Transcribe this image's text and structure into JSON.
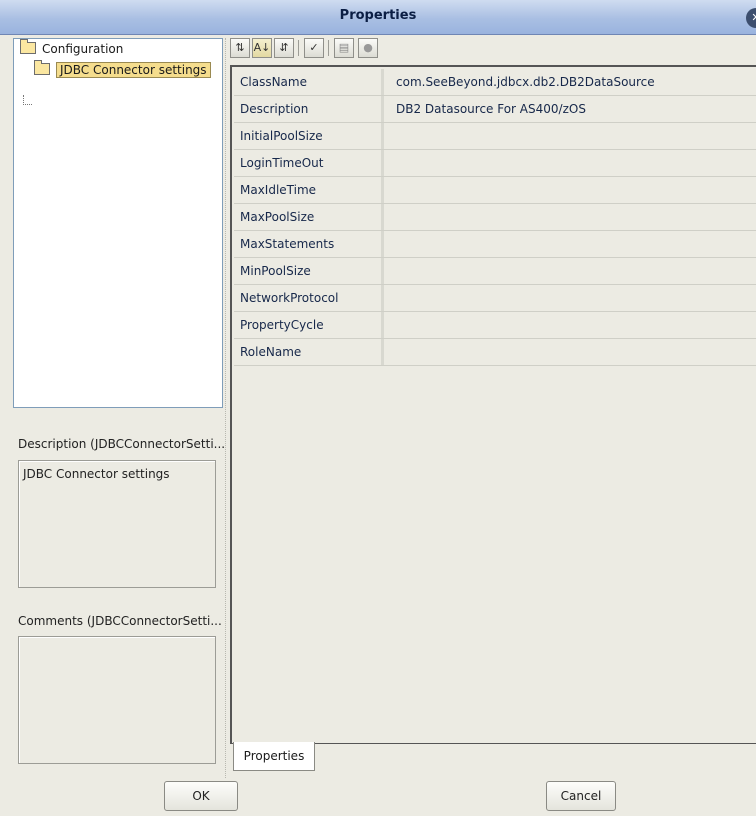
{
  "window": {
    "title": "Properties"
  },
  "tree": {
    "items": [
      {
        "label": "Configuration"
      },
      {
        "label": "JDBC Connector settings"
      }
    ]
  },
  "description": {
    "label": "Description (JDBCConnectorSetti...",
    "text": "JDBC Connector settings"
  },
  "comments": {
    "label": "Comments (JDBCConnectorSetti...",
    "text": ""
  },
  "toolbar": {
    "icons": [
      "collapse-icon",
      "sort-alpha-icon",
      "sort-category-icon",
      "checklist-icon",
      "list-view-icon",
      "help-icon"
    ]
  },
  "properties": [
    {
      "name": "ClassName",
      "value": "com.SeeBeyond.jdbcx.db2.DB2DataSource"
    },
    {
      "name": "Description",
      "value": "DB2 Datasource For AS400/zOS"
    },
    {
      "name": "InitialPoolSize",
      "value": ""
    },
    {
      "name": "LoginTimeOut",
      "value": ""
    },
    {
      "name": "MaxIdleTime",
      "value": ""
    },
    {
      "name": "MaxPoolSize",
      "value": ""
    },
    {
      "name": "MaxStatements",
      "value": ""
    },
    {
      "name": "MinPoolSize",
      "value": ""
    },
    {
      "name": "NetworkProtocol",
      "value": ""
    },
    {
      "name": "PropertyCycle",
      "value": ""
    },
    {
      "name": "RoleName",
      "value": ""
    }
  ],
  "tab": {
    "label": "Properties"
  },
  "buttons": {
    "ok": "OK",
    "cancel": "Cancel"
  }
}
